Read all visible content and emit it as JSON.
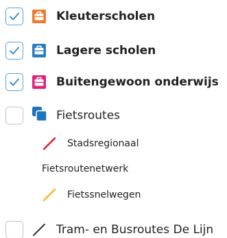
{
  "layers": [
    {
      "label": "Kleuterscholen",
      "checked": true,
      "icon": "briefcase-icon",
      "icon_color": "#f07a2c"
    },
    {
      "label": "Lagere scholen",
      "checked": true,
      "icon": "briefcase-icon",
      "icon_color": "#2a7dbf"
    },
    {
      "label": "Buitengewoon onderwijs",
      "checked": true,
      "icon": "briefcase-icon",
      "icon_color": "#e2237d"
    },
    {
      "label": "Fietsroutes",
      "checked": false,
      "icon": "stacked-layers-icon",
      "icon_color": "#1e73be"
    },
    {
      "label": "Tram- en Busroutes De Lijn",
      "checked": false,
      "icon": "line-icon",
      "icon_color": "#333333"
    }
  ],
  "sublegend": {
    "stadsregionaal": {
      "label": "Stadsregionaal",
      "color": "#e11b2a"
    },
    "group_label": "Fietsroutenetwerk",
    "fietssnelwegen": {
      "label": "Fietssnelwegen",
      "color": "#f6b52a"
    }
  },
  "colors": {
    "check_border": "#5aa1d8",
    "check_mark": "#3d8fd0",
    "unchecked_border": "#c4c4c4"
  }
}
